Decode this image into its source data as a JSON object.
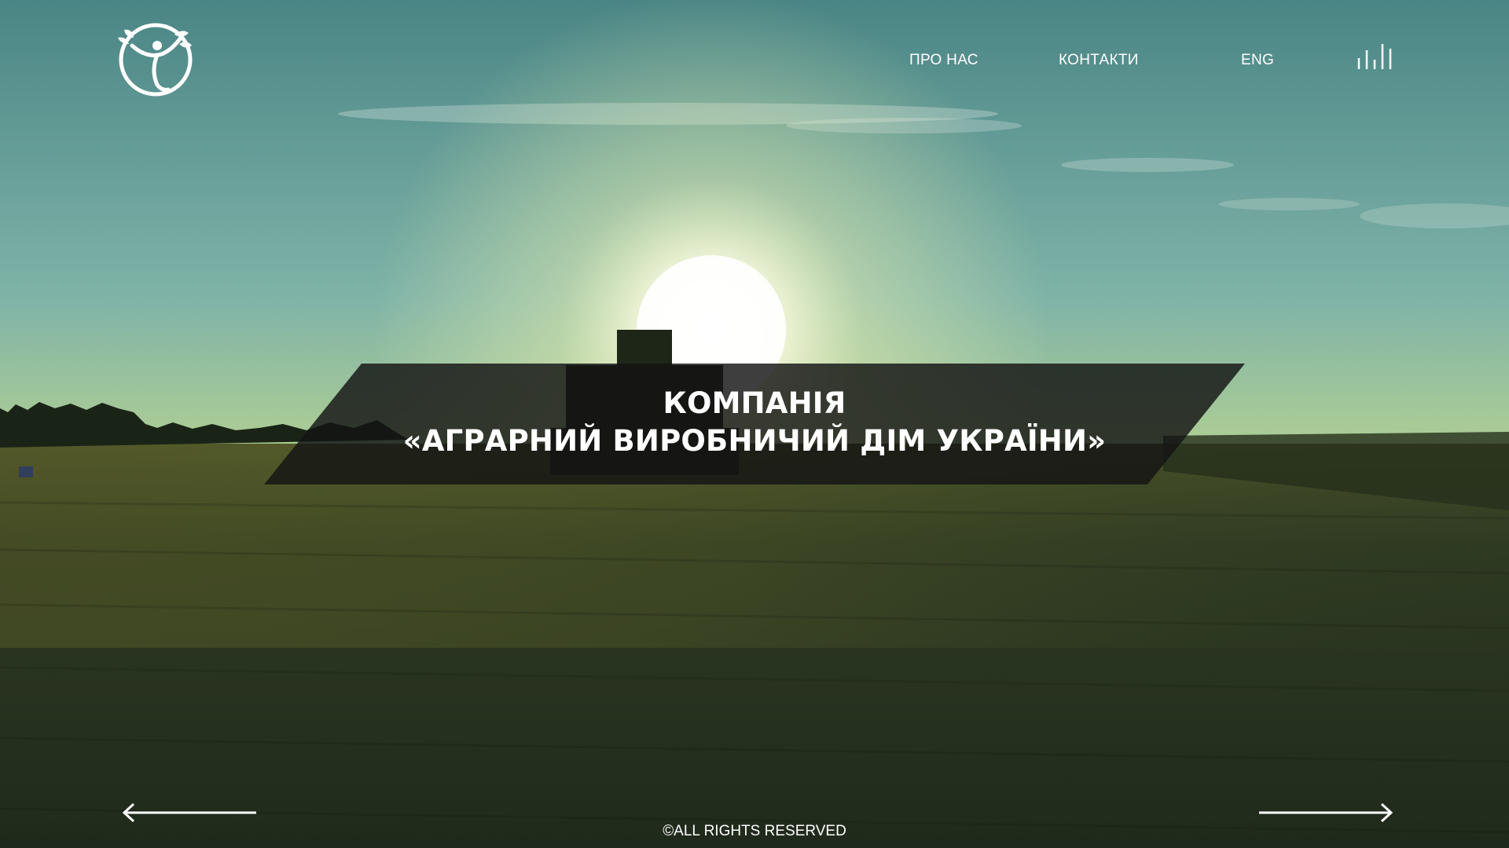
{
  "header": {
    "logo_icon": "leaf-person-circle-logo",
    "nav": {
      "about_label": "ПРО НАС",
      "contacts_label": "КОНТАКТИ",
      "language_label": "ENG"
    },
    "sound_icon": "sound-bars-icon"
  },
  "hero": {
    "title_line1": "КОМПАНІЯ",
    "title_line2": "«АГРАРНИЙ ВИРОБНИЧИЙ ДІМ УКРАЇНИ»"
  },
  "footer": {
    "prev_icon": "arrow-left-icon",
    "next_icon": "arrow-right-icon",
    "copyright": "©ALL RIGHTS RESERVED"
  },
  "colors": {
    "text": "#ffffff",
    "sky_top": "#4f8a8a",
    "sun_glow": "#fbfbd2",
    "horizon": "#c8d64a",
    "field": "#2b3620",
    "banner": "#141414"
  }
}
